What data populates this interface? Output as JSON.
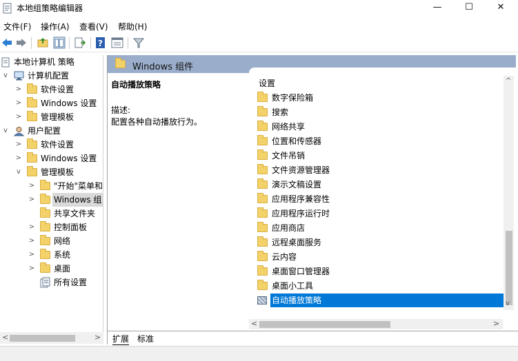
{
  "window": {
    "title": "本地组策略编辑器",
    "minimize": "—",
    "maximize": "☐",
    "close": "✕"
  },
  "menu": [
    "文件(F)",
    "操作(A)",
    "查看(V)",
    "帮助(H)"
  ],
  "toolbar": {
    "icons": [
      "back-icon",
      "forward-icon",
      "up-folder-icon",
      "show-hide-tree-icon",
      "export-list-icon",
      "help-icon",
      "properties-icon",
      "filter-icon"
    ]
  },
  "tree": [
    {
      "label": "本地计算机 策略",
      "level": 0,
      "icon": "policy-doc-icon"
    },
    {
      "label": "计算机配置",
      "level": 1,
      "icon": "computer-icon"
    },
    {
      "label": "软件设置",
      "level": 2,
      "icon": "folder-icon"
    },
    {
      "label": "Windows 设置",
      "level": 2,
      "icon": "folder-icon"
    },
    {
      "label": "管理模板",
      "level": 2,
      "icon": "folder-icon"
    },
    {
      "label": "用户配置",
      "level": 1,
      "icon": "user-icon"
    },
    {
      "label": "软件设置",
      "level": 2,
      "icon": "folder-icon"
    },
    {
      "label": "Windows 设置",
      "level": 2,
      "icon": "folder-icon"
    },
    {
      "label": "管理模板",
      "level": 2,
      "icon": "folder-icon"
    },
    {
      "label": "\"开始\"菜单和",
      "level": 3,
      "icon": "folder-icon"
    },
    {
      "label": "Windows 组",
      "level": 3,
      "icon": "folder-icon"
    },
    {
      "label": "共享文件夹",
      "level": 3,
      "icon": "folder-icon"
    },
    {
      "label": "控制面板",
      "level": 3,
      "icon": "folder-icon"
    },
    {
      "label": "网络",
      "level": 3,
      "icon": "folder-icon"
    },
    {
      "label": "系统",
      "level": 3,
      "icon": "folder-icon"
    },
    {
      "label": "桌面",
      "level": 3,
      "icon": "folder-icon"
    },
    {
      "label": "所有设置",
      "level": 3,
      "icon": "all-settings-icon"
    }
  ],
  "right_panel": {
    "header": "Windows 组件",
    "desc_title": "自动播放策略",
    "desc_label": "描述:",
    "desc_text": "配置各种自动播放行为。",
    "column_header": "设置",
    "items": [
      "数字保险箱",
      "搜索",
      "网络共享",
      "位置和传感器",
      "文件吊销",
      "文件资源管理器",
      "演示文稿设置",
      "应用程序兼容性",
      "应用程序运行时",
      "应用商店",
      "远程桌面服务",
      "云内容",
      "桌面窗口管理器",
      "桌面小工具",
      "自动播放策略"
    ],
    "selected_item": "自动播放策略"
  },
  "tabs": [
    "扩展",
    "标准"
  ],
  "colors": {
    "header_band": "#9aaecb",
    "selection": "#0078d7",
    "folder": "#f4d26a"
  }
}
